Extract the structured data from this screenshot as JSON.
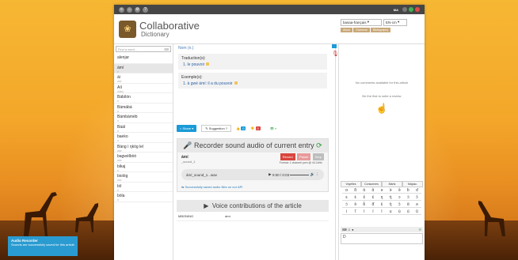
{
  "topbar": {
    "user": "MA"
  },
  "header": {
    "title": "Collaborative",
    "subtitle": "Dictionary",
    "lang_from": "basaa-français",
    "lang_to": "EN-cm",
    "tabs": [
      "About",
      "Grammar",
      "Bibliography"
    ]
  },
  "sidebar": {
    "search_placeholder": "Find a word...",
    "words": [
      {
        "w": "alenjar",
        "g": ""
      },
      {
        "w": "ámí",
        "g": "n"
      },
      {
        "w": "ái",
        "g": "adv"
      },
      {
        "w": "Aíí",
        "g": "interj"
      },
      {
        "w": "Bábílón",
        "g": "n"
      },
      {
        "w": "Bámábá",
        "g": "n"
      },
      {
        "w": "Bámbámèb",
        "g": "n"
      },
      {
        "w": "Báál",
        "g": "n"
      },
      {
        "w": "baeko",
        "g": "n"
      },
      {
        "w": "Bàng ì ŋkòg lel",
        "g": "adv"
      },
      {
        "w": "bagwèlbòò",
        "g": "adv"
      },
      {
        "w": "bikaj",
        "g": "n"
      },
      {
        "w": "biológ",
        "g": "adv"
      },
      {
        "w": "bíí",
        "g": "n"
      },
      {
        "w": "bòla",
        "g": "n"
      }
    ]
  },
  "entry": {
    "pos": "Nom (n.)",
    "translation_heading": "Traduction(s):",
    "translation": "1. le pouvoir",
    "example_heading": "Exemple(s):",
    "example": "1. à gwé ámí: il a du pouvoir",
    "share": "Share",
    "suggestion": "Suggestion ?",
    "likes": "0",
    "dislikes": "0"
  },
  "recorder": {
    "title": "Recorder sound audio of current entry",
    "word": "ámí",
    "file": "_sound_1",
    "buttons": [
      "Record",
      "Pause",
      "Stop"
    ],
    "format": "Format: 1 channel pcm @ 44.1kHz",
    "player_file": "ámí_sound_1...wav",
    "time": "0:00 / 0:03",
    "saved": "Successfully saved audio files on our API"
  },
  "contrib": {
    "title": "Voice contributions of the article",
    "row_user": "MBONING",
    "row_word": "ámí"
  },
  "comments": {
    "none": "No comments available for this article",
    "first": "Be the first to write a review",
    "kb_tabs": [
      "Voyelles",
      "Consonnes",
      "Marts",
      "Majusc."
    ],
    "keys": [
      "ɑ",
      "ɑ̃",
      "ɑ̀",
      "ɑ̂",
      "ǝ",
      "ǝ̀",
      "ǝ̂",
      "ɓ",
      "ɗ",
      "ɛ",
      "ɛ̀",
      "ɛ̂",
      "ɛ́",
      "ŋ",
      "ŋ̀",
      "ɔ",
      "ɔ̀",
      "ɔ̂",
      "ɔ́",
      "ǝ̌",
      "ɓ̌",
      "ɗ̌",
      "ɛ̌",
      "ŋ̌",
      "ɔ̌",
      "ɑ̌",
      "ə",
      "i",
      "ĩ",
      "ì",
      "í",
      "ǐ",
      "u",
      "ù",
      "ú",
      "ǔ"
    ],
    "input": "D"
  },
  "toast": {
    "title": "Audio Recorder",
    "text": "Sounds are successfully saved for this article"
  }
}
